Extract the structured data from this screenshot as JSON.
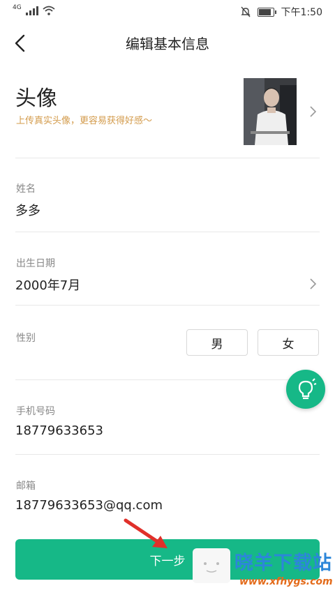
{
  "status_bar": {
    "network": "4G",
    "time": "下午1:50"
  },
  "nav": {
    "title": "编辑基本信息"
  },
  "avatar": {
    "title": "头像",
    "hint": "上传真实头像，更容易获得好感～"
  },
  "fields": {
    "name_label": "姓名",
    "name_value": "多多",
    "birth_label": "出生日期",
    "birth_value": "2000年7月",
    "gender_label": "性别",
    "gender_male": "男",
    "gender_female": "女",
    "phone_label": "手机号码",
    "phone_value": "18779633653",
    "email_label": "邮箱",
    "email_value": "18779633653@qq.com"
  },
  "next_button": "下一步",
  "watermark": {
    "text": "晓羊下载站",
    "url": "www.xfhygs.com"
  },
  "colors": {
    "accent": "#16b887",
    "hint": "#d39b4b"
  }
}
